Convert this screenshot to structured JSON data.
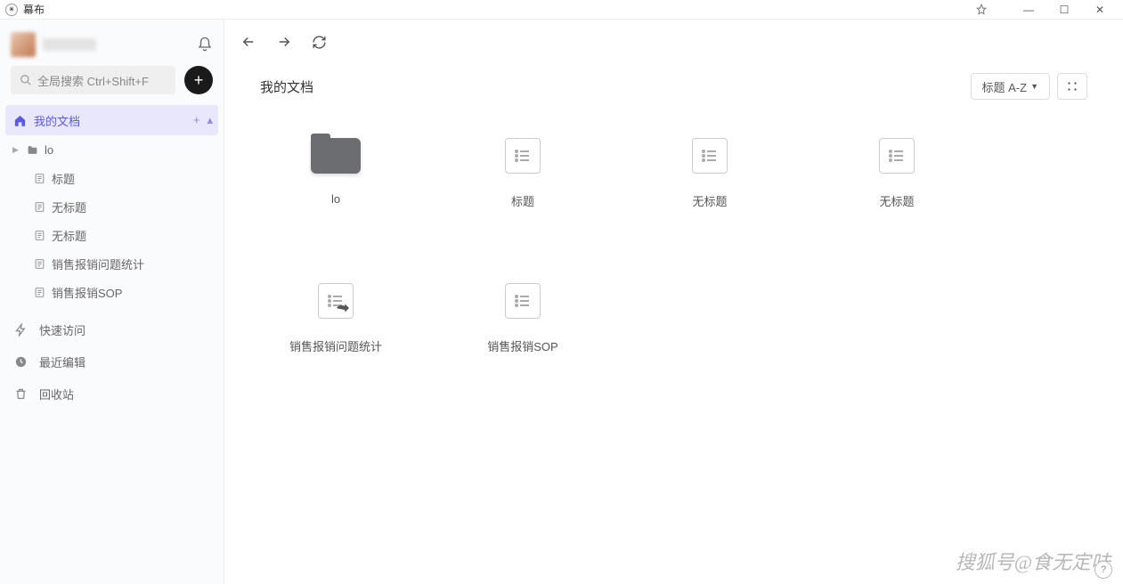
{
  "app_name": "幕布",
  "search": {
    "placeholder": "全局搜索 Ctrl+Shift+F"
  },
  "sidebar": {
    "my_docs": "我的文档",
    "tree": [
      {
        "type": "folder",
        "label": "lo"
      },
      {
        "type": "doc",
        "label": "标题"
      },
      {
        "type": "doc",
        "label": "无标题"
      },
      {
        "type": "doc",
        "label": "无标题"
      },
      {
        "type": "doc",
        "label": "销售报销问题统计"
      },
      {
        "type": "doc",
        "label": "销售报销SOP"
      }
    ],
    "quick_access": "快速访问",
    "recent_edit": "最近编辑",
    "trash": "回收站"
  },
  "main": {
    "title": "我的文档",
    "sort_label": "标题 A-Z",
    "items": [
      {
        "kind": "folder",
        "label": "lo"
      },
      {
        "kind": "doc",
        "label": "标题"
      },
      {
        "kind": "doc",
        "label": "无标题"
      },
      {
        "kind": "doc",
        "label": "无标题"
      },
      {
        "kind": "doc-share",
        "label": "销售报销问题统计"
      },
      {
        "kind": "doc",
        "label": "销售报销SOP"
      }
    ]
  },
  "watermark": "搜狐号@食无定味",
  "help": "?"
}
